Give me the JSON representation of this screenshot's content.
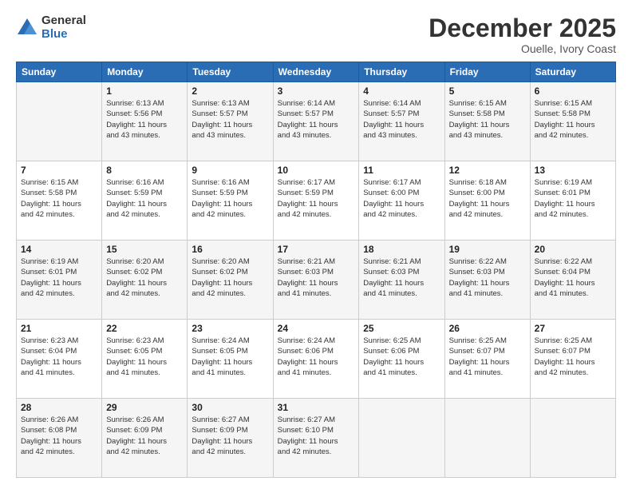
{
  "header": {
    "logo_general": "General",
    "logo_blue": "Blue",
    "month_title": "December 2025",
    "location": "Ouelle, Ivory Coast"
  },
  "calendar": {
    "days_of_week": [
      "Sunday",
      "Monday",
      "Tuesday",
      "Wednesday",
      "Thursday",
      "Friday",
      "Saturday"
    ],
    "weeks": [
      [
        {
          "day": "",
          "info": ""
        },
        {
          "day": "1",
          "info": "Sunrise: 6:13 AM\nSunset: 5:56 PM\nDaylight: 11 hours\nand 43 minutes."
        },
        {
          "day": "2",
          "info": "Sunrise: 6:13 AM\nSunset: 5:57 PM\nDaylight: 11 hours\nand 43 minutes."
        },
        {
          "day": "3",
          "info": "Sunrise: 6:14 AM\nSunset: 5:57 PM\nDaylight: 11 hours\nand 43 minutes."
        },
        {
          "day": "4",
          "info": "Sunrise: 6:14 AM\nSunset: 5:57 PM\nDaylight: 11 hours\nand 43 minutes."
        },
        {
          "day": "5",
          "info": "Sunrise: 6:15 AM\nSunset: 5:58 PM\nDaylight: 11 hours\nand 43 minutes."
        },
        {
          "day": "6",
          "info": "Sunrise: 6:15 AM\nSunset: 5:58 PM\nDaylight: 11 hours\nand 42 minutes."
        }
      ],
      [
        {
          "day": "7",
          "info": "Sunrise: 6:15 AM\nSunset: 5:58 PM\nDaylight: 11 hours\nand 42 minutes."
        },
        {
          "day": "8",
          "info": "Sunrise: 6:16 AM\nSunset: 5:59 PM\nDaylight: 11 hours\nand 42 minutes."
        },
        {
          "day": "9",
          "info": "Sunrise: 6:16 AM\nSunset: 5:59 PM\nDaylight: 11 hours\nand 42 minutes."
        },
        {
          "day": "10",
          "info": "Sunrise: 6:17 AM\nSunset: 5:59 PM\nDaylight: 11 hours\nand 42 minutes."
        },
        {
          "day": "11",
          "info": "Sunrise: 6:17 AM\nSunset: 6:00 PM\nDaylight: 11 hours\nand 42 minutes."
        },
        {
          "day": "12",
          "info": "Sunrise: 6:18 AM\nSunset: 6:00 PM\nDaylight: 11 hours\nand 42 minutes."
        },
        {
          "day": "13",
          "info": "Sunrise: 6:19 AM\nSunset: 6:01 PM\nDaylight: 11 hours\nand 42 minutes."
        }
      ],
      [
        {
          "day": "14",
          "info": "Sunrise: 6:19 AM\nSunset: 6:01 PM\nDaylight: 11 hours\nand 42 minutes."
        },
        {
          "day": "15",
          "info": "Sunrise: 6:20 AM\nSunset: 6:02 PM\nDaylight: 11 hours\nand 42 minutes."
        },
        {
          "day": "16",
          "info": "Sunrise: 6:20 AM\nSunset: 6:02 PM\nDaylight: 11 hours\nand 42 minutes."
        },
        {
          "day": "17",
          "info": "Sunrise: 6:21 AM\nSunset: 6:03 PM\nDaylight: 11 hours\nand 41 minutes."
        },
        {
          "day": "18",
          "info": "Sunrise: 6:21 AM\nSunset: 6:03 PM\nDaylight: 11 hours\nand 41 minutes."
        },
        {
          "day": "19",
          "info": "Sunrise: 6:22 AM\nSunset: 6:03 PM\nDaylight: 11 hours\nand 41 minutes."
        },
        {
          "day": "20",
          "info": "Sunrise: 6:22 AM\nSunset: 6:04 PM\nDaylight: 11 hours\nand 41 minutes."
        }
      ],
      [
        {
          "day": "21",
          "info": "Sunrise: 6:23 AM\nSunset: 6:04 PM\nDaylight: 11 hours\nand 41 minutes."
        },
        {
          "day": "22",
          "info": "Sunrise: 6:23 AM\nSunset: 6:05 PM\nDaylight: 11 hours\nand 41 minutes."
        },
        {
          "day": "23",
          "info": "Sunrise: 6:24 AM\nSunset: 6:05 PM\nDaylight: 11 hours\nand 41 minutes."
        },
        {
          "day": "24",
          "info": "Sunrise: 6:24 AM\nSunset: 6:06 PM\nDaylight: 11 hours\nand 41 minutes."
        },
        {
          "day": "25",
          "info": "Sunrise: 6:25 AM\nSunset: 6:06 PM\nDaylight: 11 hours\nand 41 minutes."
        },
        {
          "day": "26",
          "info": "Sunrise: 6:25 AM\nSunset: 6:07 PM\nDaylight: 11 hours\nand 41 minutes."
        },
        {
          "day": "27",
          "info": "Sunrise: 6:25 AM\nSunset: 6:07 PM\nDaylight: 11 hours\nand 42 minutes."
        }
      ],
      [
        {
          "day": "28",
          "info": "Sunrise: 6:26 AM\nSunset: 6:08 PM\nDaylight: 11 hours\nand 42 minutes."
        },
        {
          "day": "29",
          "info": "Sunrise: 6:26 AM\nSunset: 6:09 PM\nDaylight: 11 hours\nand 42 minutes."
        },
        {
          "day": "30",
          "info": "Sunrise: 6:27 AM\nSunset: 6:09 PM\nDaylight: 11 hours\nand 42 minutes."
        },
        {
          "day": "31",
          "info": "Sunrise: 6:27 AM\nSunset: 6:10 PM\nDaylight: 11 hours\nand 42 minutes."
        },
        {
          "day": "",
          "info": ""
        },
        {
          "day": "",
          "info": ""
        },
        {
          "day": "",
          "info": ""
        }
      ]
    ]
  }
}
